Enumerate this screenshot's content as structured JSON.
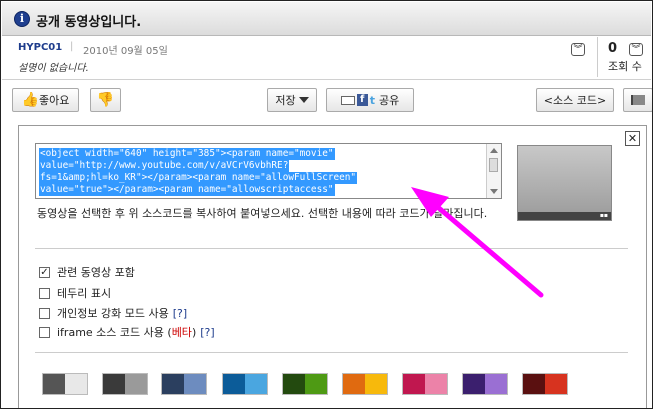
{
  "header": {
    "title": "공개 동영상입니다."
  },
  "meta": {
    "uploader": "HYPC01",
    "date": "2010년 09월 05일",
    "description": "설명이 없습니다.",
    "views_count": "0",
    "views_label": "조회 수"
  },
  "toolbar": {
    "like_label": "좋아요",
    "save_label": "저장",
    "share_label": "공유",
    "source_code_label": "<소스 코드>"
  },
  "embed": {
    "code_lines": [
      "<object width=\"640\" height=\"385\"><param name=\"movie\"",
      "value=\"http://www.youtube.com/v/aVCrV6vbhRE?",
      "fs=1&amp;hl=ko_KR\"></param><param name=\"allowFullScreen\"",
      "value=\"true\"></param><param name=\"allowscriptaccess\""
    ],
    "hint": "동영상을 선택한 후 위 소스코드를 복사하여 붙여넣으세요. 선택한 내용에 따라 코드가 달라집니다."
  },
  "options": [
    {
      "label": "관련 동영상 포함",
      "checked": true,
      "help": "",
      "beta": ""
    },
    {
      "label": "테두리 표시",
      "checked": false,
      "help": "",
      "beta": ""
    },
    {
      "label": "개인정보 강화 모드 사용",
      "checked": false,
      "help": "[?]",
      "beta": ""
    },
    {
      "label": "iframe 소스 코드 사용 (",
      "checked": false,
      "help": "[?]",
      "beta": "베타"
    }
  ],
  "swatches": [
    [
      "#555555",
      "#e8e8e8"
    ],
    [
      "#3a3a3a",
      "#9a9a9a"
    ],
    [
      "#2b3f5f",
      "#6d8cbf"
    ],
    [
      "#0c5c99",
      "#4aa6e0"
    ],
    [
      "#234a0f",
      "#4e9a14"
    ],
    [
      "#e06a10",
      "#f7b90c"
    ],
    [
      "#c0174f",
      "#ec82a8"
    ],
    [
      "#3b1f6e",
      "#9a6fd3"
    ],
    [
      "#5a1010",
      "#d7331f"
    ]
  ],
  "colors": {
    "header_icon": "#1f3f8f",
    "selection": "#3399ff",
    "annotation_arrow": "#ff00ff"
  }
}
